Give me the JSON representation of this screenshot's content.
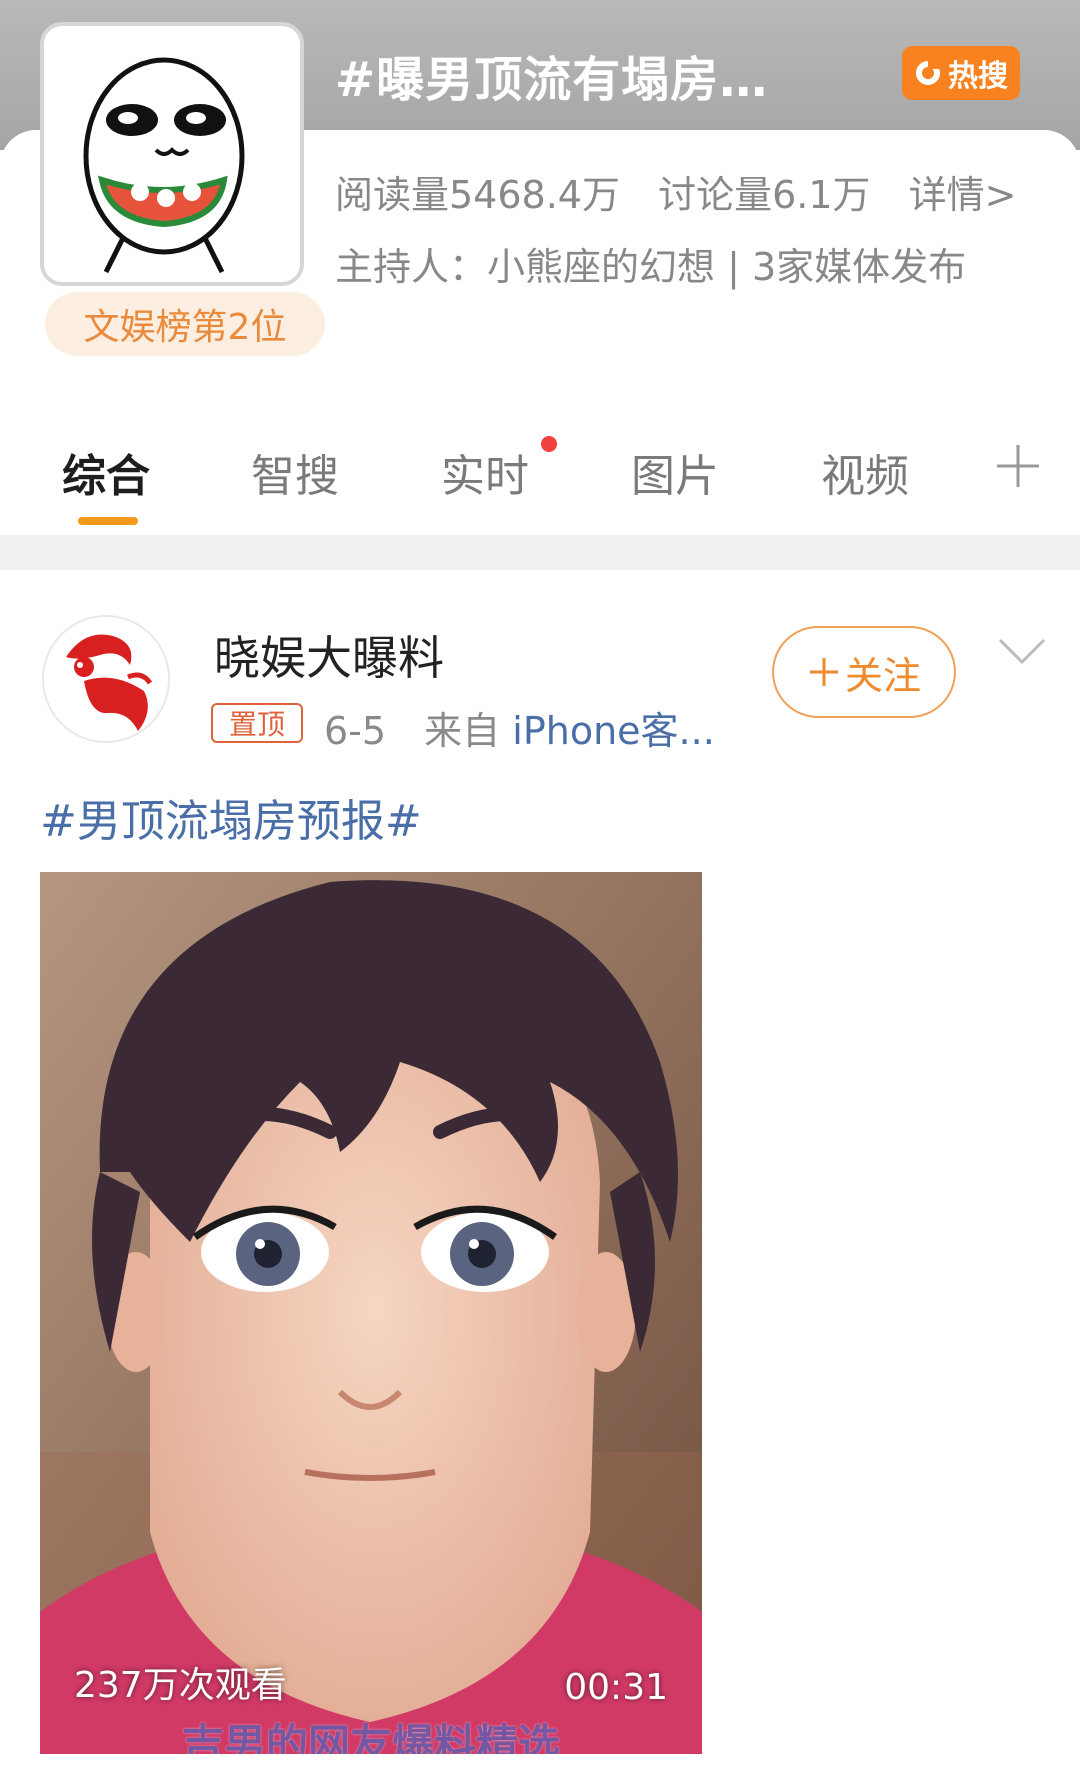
{
  "topic": {
    "title": "#曝男顶流有塌房…",
    "hot_badge_label": "热搜",
    "rank_label": "文娱榜第2位",
    "read_count": "阅读量5468.4万",
    "discussion_count": "讨论量6.1万",
    "detail_link": "详情>",
    "host_line": "主持人：小熊座的幻想 | 3家媒体发布"
  },
  "tabs": [
    {
      "label": "综合"
    },
    {
      "label": "智搜"
    },
    {
      "label": "实时"
    },
    {
      "label": "图片"
    },
    {
      "label": "视频"
    }
  ],
  "post": {
    "username": "晓娱大曝料",
    "pin_label": "置顶",
    "date": "6-5",
    "source_prefix": "来自",
    "source": "iPhone客...",
    "follow_label": "关注",
    "text": "#男顶流塌房预报#",
    "video": {
      "views": "237万次观看",
      "duration": "00:31",
      "subtitle": "吉男的网友爆料精选"
    }
  },
  "colors": {
    "accent_orange": "#f39a1c",
    "hot_badge": "#f7821f",
    "link_blue": "#4a6ea7",
    "pin_red": "#e1623a"
  }
}
